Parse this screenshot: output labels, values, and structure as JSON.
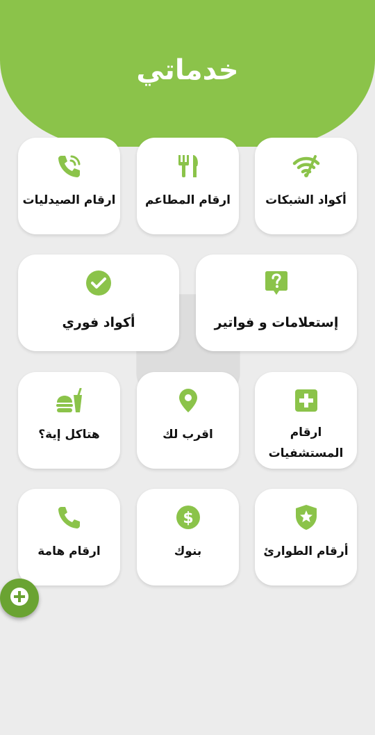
{
  "app_title": "خدماتي",
  "colors": {
    "accent": "#8bc34a",
    "fab": "#6aa332",
    "background": "#ececec"
  },
  "tiles": [
    {
      "label": "أكواد الشبكات",
      "icon": "wifi-signal-icon"
    },
    {
      "label": "ارقام المطاعم",
      "icon": "fork-knife-icon"
    },
    {
      "label": "ارقام الصيدليات",
      "icon": "phone-call-icon"
    },
    {
      "label": "إستعلامات و فواتير",
      "icon": "question-bubble-icon"
    },
    {
      "label": "أكواد فوري",
      "icon": "check-circle-icon"
    },
    {
      "label": "ارقام المستشفيات",
      "icon": "medical-plus-icon"
    },
    {
      "label": "اقرب لك",
      "icon": "map-pin-icon"
    },
    {
      "label": "هتاكل إية؟",
      "icon": "fast-food-icon"
    },
    {
      "label": "أرقام الطوارئ",
      "icon": "shield-star-icon"
    },
    {
      "label": "بنوك",
      "icon": "dollar-circle-icon"
    },
    {
      "label": "ارقام هامة",
      "icon": "phone-icon"
    }
  ],
  "fab_icon": "add-icon"
}
